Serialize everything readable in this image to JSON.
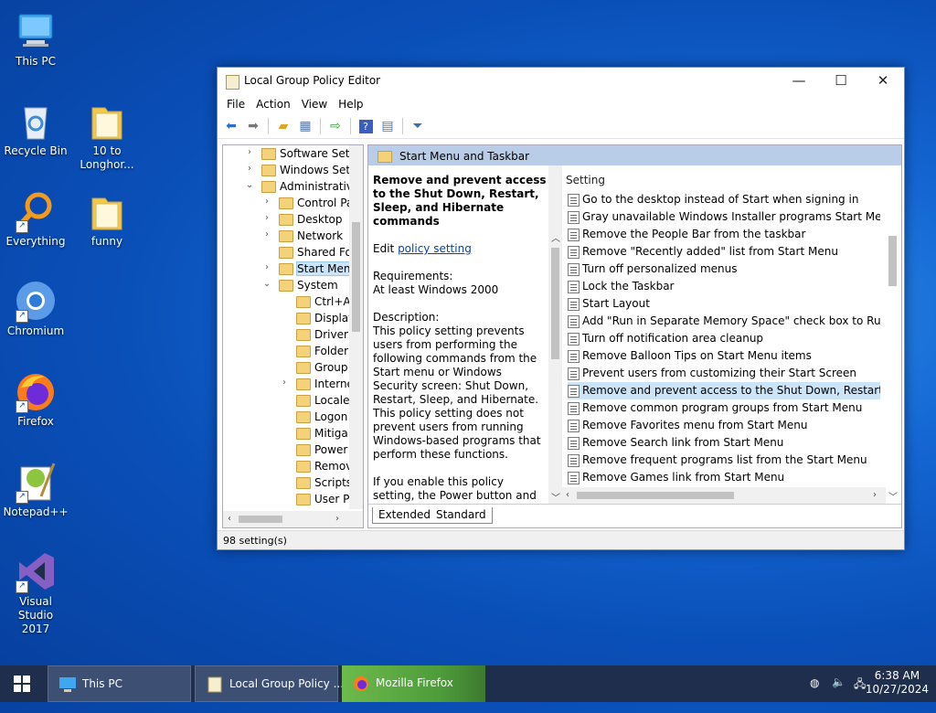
{
  "desktop": {
    "icons": [
      {
        "label": "This PC"
      },
      {
        "label": "Recycle Bin"
      },
      {
        "label": "10 to Longhor..."
      },
      {
        "label": "Everything"
      },
      {
        "label": "funny"
      },
      {
        "label": "Chromium"
      },
      {
        "label": "Firefox"
      },
      {
        "label": "Notepad++"
      },
      {
        "label": "Visual Studio 2017"
      }
    ]
  },
  "window": {
    "title": "Local Group Policy Editor",
    "minimize": "—",
    "maximize": "☐",
    "close": "✕",
    "menu": [
      "File",
      "Action",
      "View",
      "Help"
    ],
    "tree": [
      {
        "label": "Software Setti",
        "exp": "›",
        "indent": 0
      },
      {
        "label": "Windows Sett",
        "exp": "›",
        "indent": 0
      },
      {
        "label": "Administrative",
        "exp": "⌄",
        "indent": 0
      },
      {
        "label": "Control Pa",
        "exp": "›",
        "indent": 1
      },
      {
        "label": "Desktop",
        "exp": "›",
        "indent": 1
      },
      {
        "label": "Network",
        "exp": "›",
        "indent": 1
      },
      {
        "label": "Shared Fol",
        "exp": "",
        "indent": 1
      },
      {
        "label": "Start Menu",
        "exp": "›",
        "indent": 1
      },
      {
        "label": "System",
        "exp": "⌄",
        "indent": 1
      },
      {
        "label": "Ctrl+A",
        "exp": "",
        "indent": 2
      },
      {
        "label": "Display",
        "exp": "",
        "indent": 2
      },
      {
        "label": "Driver",
        "exp": "",
        "indent": 2
      },
      {
        "label": "Folder",
        "exp": "",
        "indent": 2
      },
      {
        "label": "Group",
        "exp": "",
        "indent": 2
      },
      {
        "label": "Interne",
        "exp": "›",
        "indent": 2
      },
      {
        "label": "Locale",
        "exp": "",
        "indent": 2
      },
      {
        "label": "Logon",
        "exp": "",
        "indent": 2
      },
      {
        "label": "Mitiga",
        "exp": "",
        "indent": 2
      },
      {
        "label": "Power",
        "exp": "",
        "indent": 2
      },
      {
        "label": "Remov",
        "exp": "",
        "indent": 2
      },
      {
        "label": "Scripts",
        "exp": "",
        "indent": 2
      },
      {
        "label": "User P",
        "exp": "",
        "indent": 2
      }
    ],
    "panel_title": "Start Menu and Taskbar",
    "description": {
      "heading": "Remove and prevent access to the Shut Down, Restart, Sleep, and Hibernate commands",
      "edit_prefix": "Edit ",
      "edit_link": "policy setting",
      "requirements_label": "Requirements:",
      "requirements": "At least Windows 2000",
      "description_label": "Description:",
      "body1": "This policy setting prevents users from performing the following commands from the Start menu or Windows Security screen: Shut Down, Restart, Sleep, and Hibernate. This policy setting does not prevent users from running Windows-based programs that perform these functions.",
      "body2": "If you enable this policy setting, the Power button and the Shut Down, Restart, Sleep, and Hibernate commands are"
    },
    "list_header": "Setting",
    "settings": [
      "Go to the desktop instead of Start when signing in",
      "Gray unavailable Windows Installer programs Start Menu sh...",
      "Remove the People Bar from the taskbar",
      "Remove \"Recently added\" list from Start Menu",
      "Turn off personalized menus",
      "Lock the Taskbar",
      "Start Layout",
      "Add \"Run in Separate Memory Space\" check box to Run dial...",
      "Turn off notification area cleanup",
      "Remove Balloon Tips on Start Menu items",
      "Prevent users from customizing their Start Screen",
      "Remove and prevent access to the Shut Down, Restart, Sleep...",
      "Remove common program groups from Start Menu",
      "Remove Favorites menu from Start Menu",
      "Remove Search link from Start Menu",
      "Remove frequent programs list from the Start Menu",
      "Remove Games link from Start Menu"
    ],
    "tabs": [
      "Extended",
      "Standard"
    ],
    "status": "98 setting(s)"
  },
  "taskbar": {
    "buttons": [
      "This PC",
      "Local Group Policy ...",
      "Mozilla Firefox"
    ],
    "time": "6:38 AM",
    "date": "10/27/2024"
  }
}
